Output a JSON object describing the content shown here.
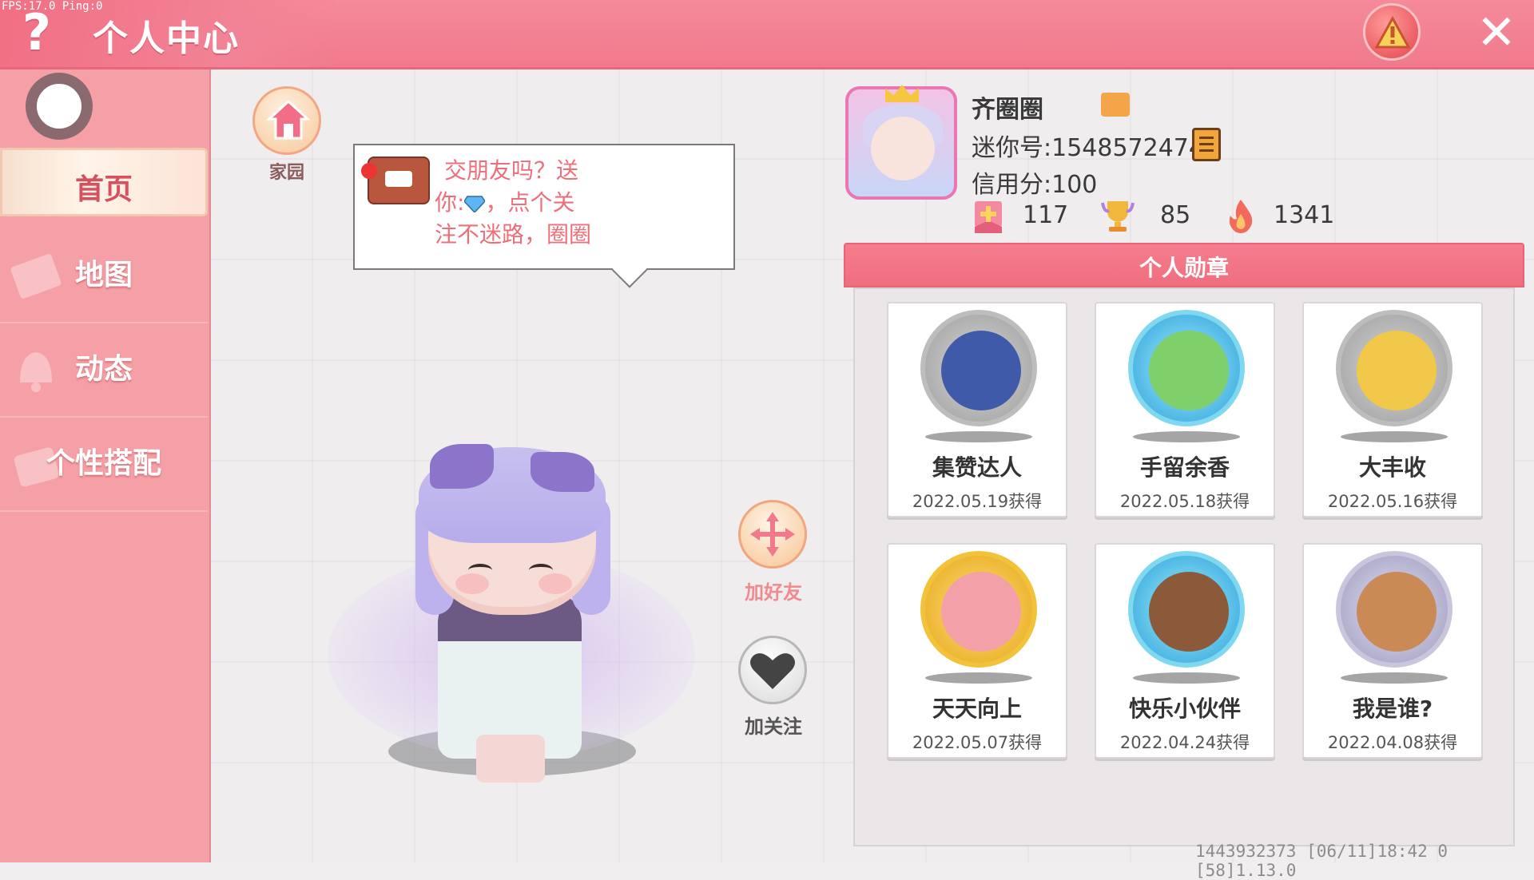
{
  "debug": {
    "fps": "FPS:17.0  Ping:0"
  },
  "header": {
    "help_label": "?",
    "title": "个人中心",
    "close_label": "✕"
  },
  "sidebar": {
    "items": [
      {
        "label": "首页",
        "active": true
      },
      {
        "label": "地图",
        "active": false
      },
      {
        "label": "动态",
        "active": false
      },
      {
        "label": "个性搭配",
        "active": false
      }
    ]
  },
  "home": {
    "label": "家园"
  },
  "bubble": {
    "line1": "交朋友吗？送",
    "line2a": "你:",
    "line2b": "，点个关",
    "line3": "注不迷路，圈圈"
  },
  "actions": {
    "add_friend": "加好友",
    "follow": "加关注"
  },
  "profile": {
    "name": "齐圈圈",
    "mini_id": "迷你号:1548572474",
    "credit": "信用分:100",
    "stats": [
      {
        "icon": "plus-flag-icon",
        "value": "117"
      },
      {
        "icon": "trophy-icon",
        "value": "85"
      },
      {
        "icon": "flame-icon",
        "value": "1341"
      }
    ]
  },
  "medals": {
    "title": "个人勋章",
    "items": [
      {
        "name": "集赞达人",
        "date": "2022.05.19获得",
        "style": "silver"
      },
      {
        "name": "手留余香",
        "date": "2022.05.18获得",
        "style": "crystal"
      },
      {
        "name": "大丰收",
        "date": "2022.05.16获得",
        "style": "silver"
      },
      {
        "name": "天天向上",
        "date": "2022.05.07获得",
        "style": "gold"
      },
      {
        "name": "快乐小伙伴",
        "date": "2022.04.24获得",
        "style": "crystal"
      },
      {
        "name": "我是谁?",
        "date": "2022.04.08获得",
        "style": "purple-silver"
      }
    ]
  },
  "footer": {
    "info": "1443932373   [06/11]18:42 0  [58]1.13.0"
  }
}
